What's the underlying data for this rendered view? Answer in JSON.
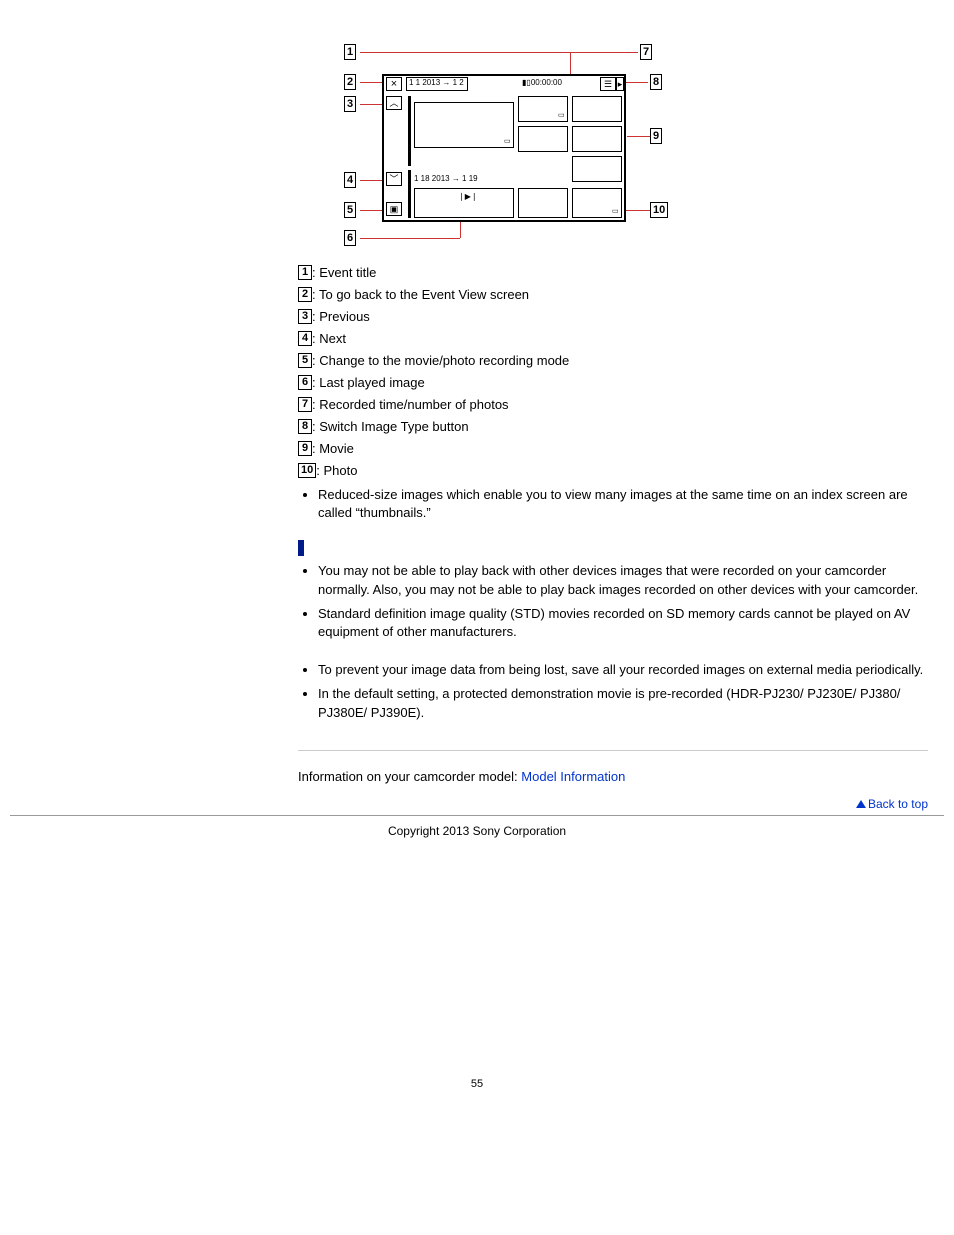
{
  "diagram": {
    "labels": [
      "1",
      "2",
      "3",
      "4",
      "5",
      "6",
      "7",
      "8",
      "9",
      "10"
    ],
    "top_date": "1 1 2013  →  1 2",
    "bottom_date": "1 18 2013  →  1 19",
    "time": "00:00:00",
    "close": "×",
    "chev_up": "︿",
    "chev_down": "﹀",
    "play": "❘▶❘",
    "cam": "▣"
  },
  "legend": [
    {
      "num": "1",
      "text": ": Event title"
    },
    {
      "num": "2",
      "text": ": To go back to the Event View screen"
    },
    {
      "num": "3",
      "text": ": Previous"
    },
    {
      "num": "4",
      "text": ": Next"
    },
    {
      "num": "5",
      "text": ": Change to the movie/photo recording mode"
    },
    {
      "num": "6",
      "text": ": Last played image"
    },
    {
      "num": "7",
      "text": ": Recorded time/number of photos"
    },
    {
      "num": "8",
      "text": ": Switch Image Type button"
    },
    {
      "num": "9",
      "text": ": Movie"
    },
    {
      "num": "10",
      "text": ": Photo"
    }
  ],
  "bullets_a": [
    "Reduced-size images which enable you to view many images at the same time on an index screen are called “thumbnails.”"
  ],
  "bullets_b": [
    "You may not be able to play back with other devices images that were recorded on your camcorder normally. Also, you may not be able to play back images recorded on other devices with your camcorder.",
    "Standard definition image quality (STD) movies recorded on SD memory cards cannot be played on AV equipment of other manufacturers."
  ],
  "bullets_c": [
    "To prevent your image data from being lost, save all your recorded images on external media periodically.",
    "In the default setting, a protected demonstration movie is pre-recorded (HDR-PJ230/ PJ230E/ PJ380/ PJ380E/ PJ390E)."
  ],
  "model_line_prefix": "Information on your camcorder model: ",
  "model_link": "Model Information",
  "back_to_top": "Back to top",
  "copyright": "Copyright 2013 Sony Corporation",
  "page_number": "55"
}
